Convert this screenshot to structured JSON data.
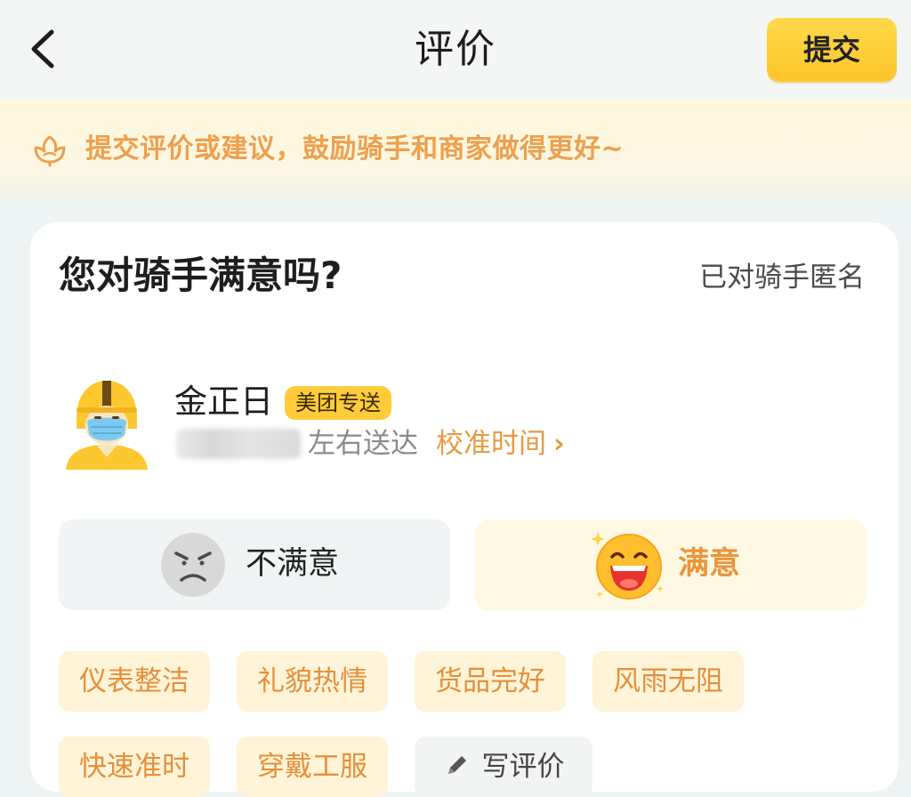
{
  "header": {
    "title": "评价",
    "submit_label": "提交"
  },
  "banner": {
    "text": "提交评价或建议，鼓励骑手和商家做得更好~"
  },
  "card": {
    "title": "您对骑手满意吗?",
    "anon_label": "已对骑手匿名",
    "rider": {
      "name": "金正日",
      "service_tag": "美团专送",
      "arrive_text": "左右送达",
      "calibrate_link": "校准时间"
    },
    "rating": {
      "bad_label": "不满意",
      "good_label": "满意",
      "selected": "满意"
    },
    "tags": [
      {
        "label": "仪表整洁"
      },
      {
        "label": "礼貌热情"
      },
      {
        "label": "货品完好"
      },
      {
        "label": "风雨无阻"
      },
      {
        "label": "快速准时"
      },
      {
        "label": "穿戴工服"
      }
    ],
    "write_review_label": "写评价"
  },
  "colors": {
    "accent_yellow": "#fec52a",
    "accent_orange": "#e9953c",
    "tag_bg": "#fff4d8"
  }
}
